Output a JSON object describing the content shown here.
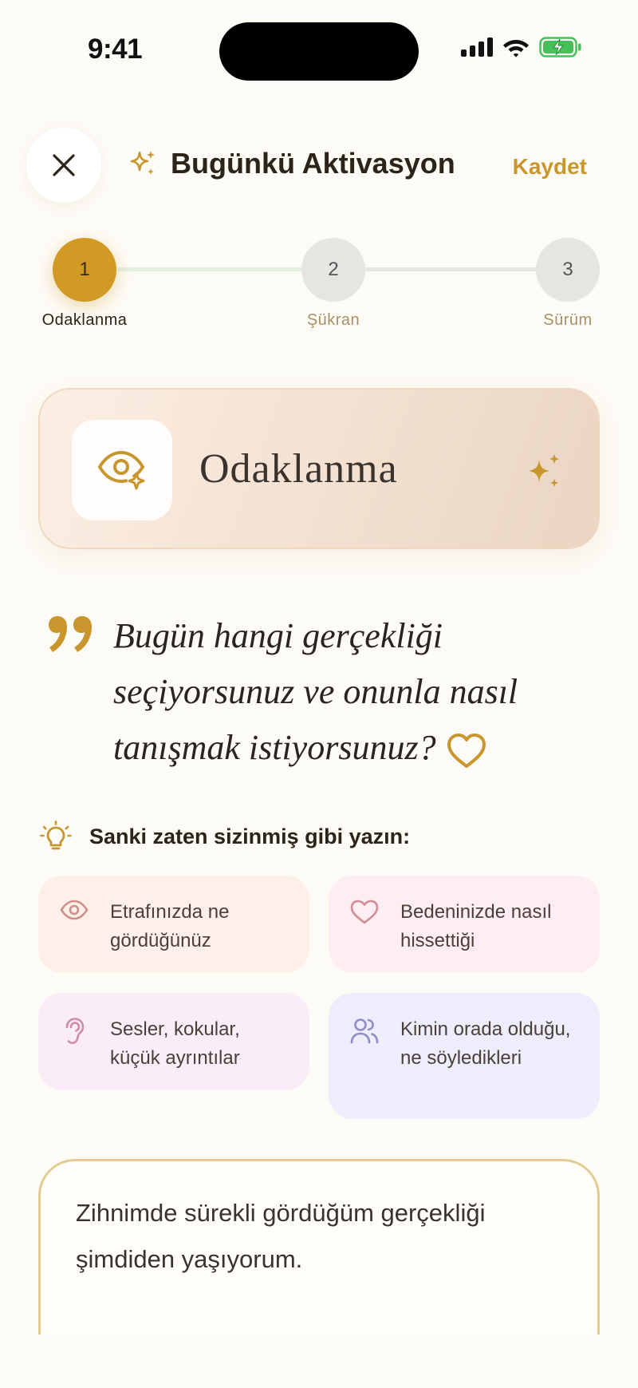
{
  "status_bar": {
    "time": "9:41"
  },
  "header": {
    "title": "Bugünkü Aktivasyon",
    "save_label": "Kaydet"
  },
  "stepper": {
    "steps": [
      {
        "number": "1",
        "label": "Odaklanma"
      },
      {
        "number": "2",
        "label": "Şükran"
      },
      {
        "number": "3",
        "label": "Sürüm"
      }
    ]
  },
  "focus_card": {
    "title": "Odaklanma"
  },
  "prompt": {
    "question": "Bugün hangi gerçekliği seçiyorsunuz ve onunla nasıl tanışmak istiyorsunuz?"
  },
  "tip": {
    "heading": "Sanki zaten sizinmiş gibi yazın:"
  },
  "hints": [
    {
      "icon": "eye-icon",
      "text": "Etrafınızda ne gördüğünüz"
    },
    {
      "icon": "heart-icon",
      "text": "Bedeninizde nasıl hissettiği"
    },
    {
      "icon": "ear-icon",
      "text": "Sesler, kokular, küçük ayrıntılar"
    },
    {
      "icon": "users-icon",
      "text": "Kimin orada olduğu, ne söyledikleri"
    }
  ],
  "entry": {
    "value": "Zihnimde sürekli gördüğüm gerçekliği şimdiden yaşıyorum."
  },
  "colors": {
    "accent": "#c9962e",
    "active_step": "#d09a25",
    "background": "#fdfbf6"
  }
}
